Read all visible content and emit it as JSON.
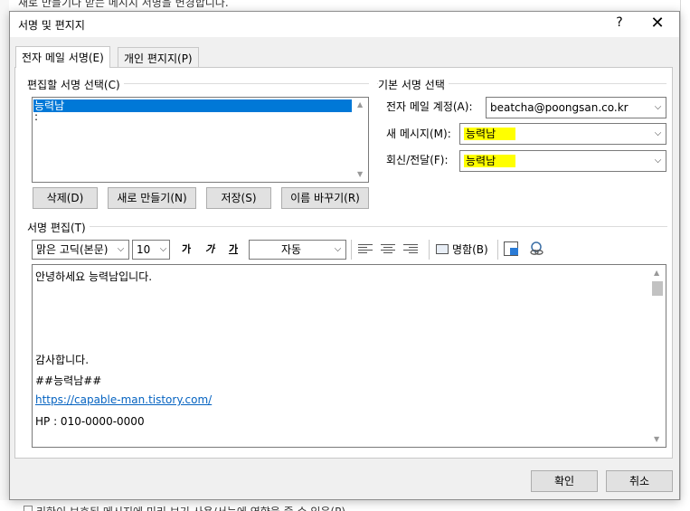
{
  "background": {
    "top_text": "새로 만들기나 받는 메시지 서명을 변경합니다.",
    "bottom_text": "리한이 보호된 메시지에 미리 보기 사용/서능에 영향을 줄 수 있음(P)"
  },
  "dialog": {
    "title": "서명 및 편지지",
    "help_glyph": "?",
    "close_glyph": "✕"
  },
  "tabs": [
    {
      "label": "전자 메일 서명(E)",
      "active": true
    },
    {
      "label": "개인 편지지(P)",
      "active": false
    }
  ],
  "select_section": {
    "label": "편집할 서명 선택(C)",
    "items": [
      "능력남",
      ":"
    ],
    "selected_index": 0
  },
  "buttons": {
    "delete": "삭제(D)",
    "new": "새로 만들기(N)",
    "save": "저장(S)",
    "rename": "이름 바꾸기(R)",
    "ok": "확인",
    "cancel": "취소"
  },
  "default_section": {
    "label": "기본 서명 선택",
    "account_label": "전자 메일 계정(A):",
    "account_value": "beatcha@poongsan.co.kr",
    "new_msg_label": "새 메시지(M):",
    "new_msg_value": "능력남",
    "reply_label": "회신/전달(F):",
    "reply_value": "능력남",
    "highlight_color": "#ffff00"
  },
  "edit_section": {
    "label": "서명 편집(T)",
    "font": "맑은 고딕(본문)",
    "size": "10",
    "bold": "가",
    "italic": "가",
    "underline": "가",
    "color": "자동",
    "business_card": "명함(B)"
  },
  "editor": {
    "lines": [
      "안녕하세요 능력남입니다.",
      "",
      "",
      "",
      "감사합니다.",
      "##능력남##",
      "https://capable-man.tistory.com/",
      "HP : 010-0000-0000"
    ],
    "link_color": "#0563c1"
  },
  "colors": {
    "selection": "#0078d7"
  }
}
